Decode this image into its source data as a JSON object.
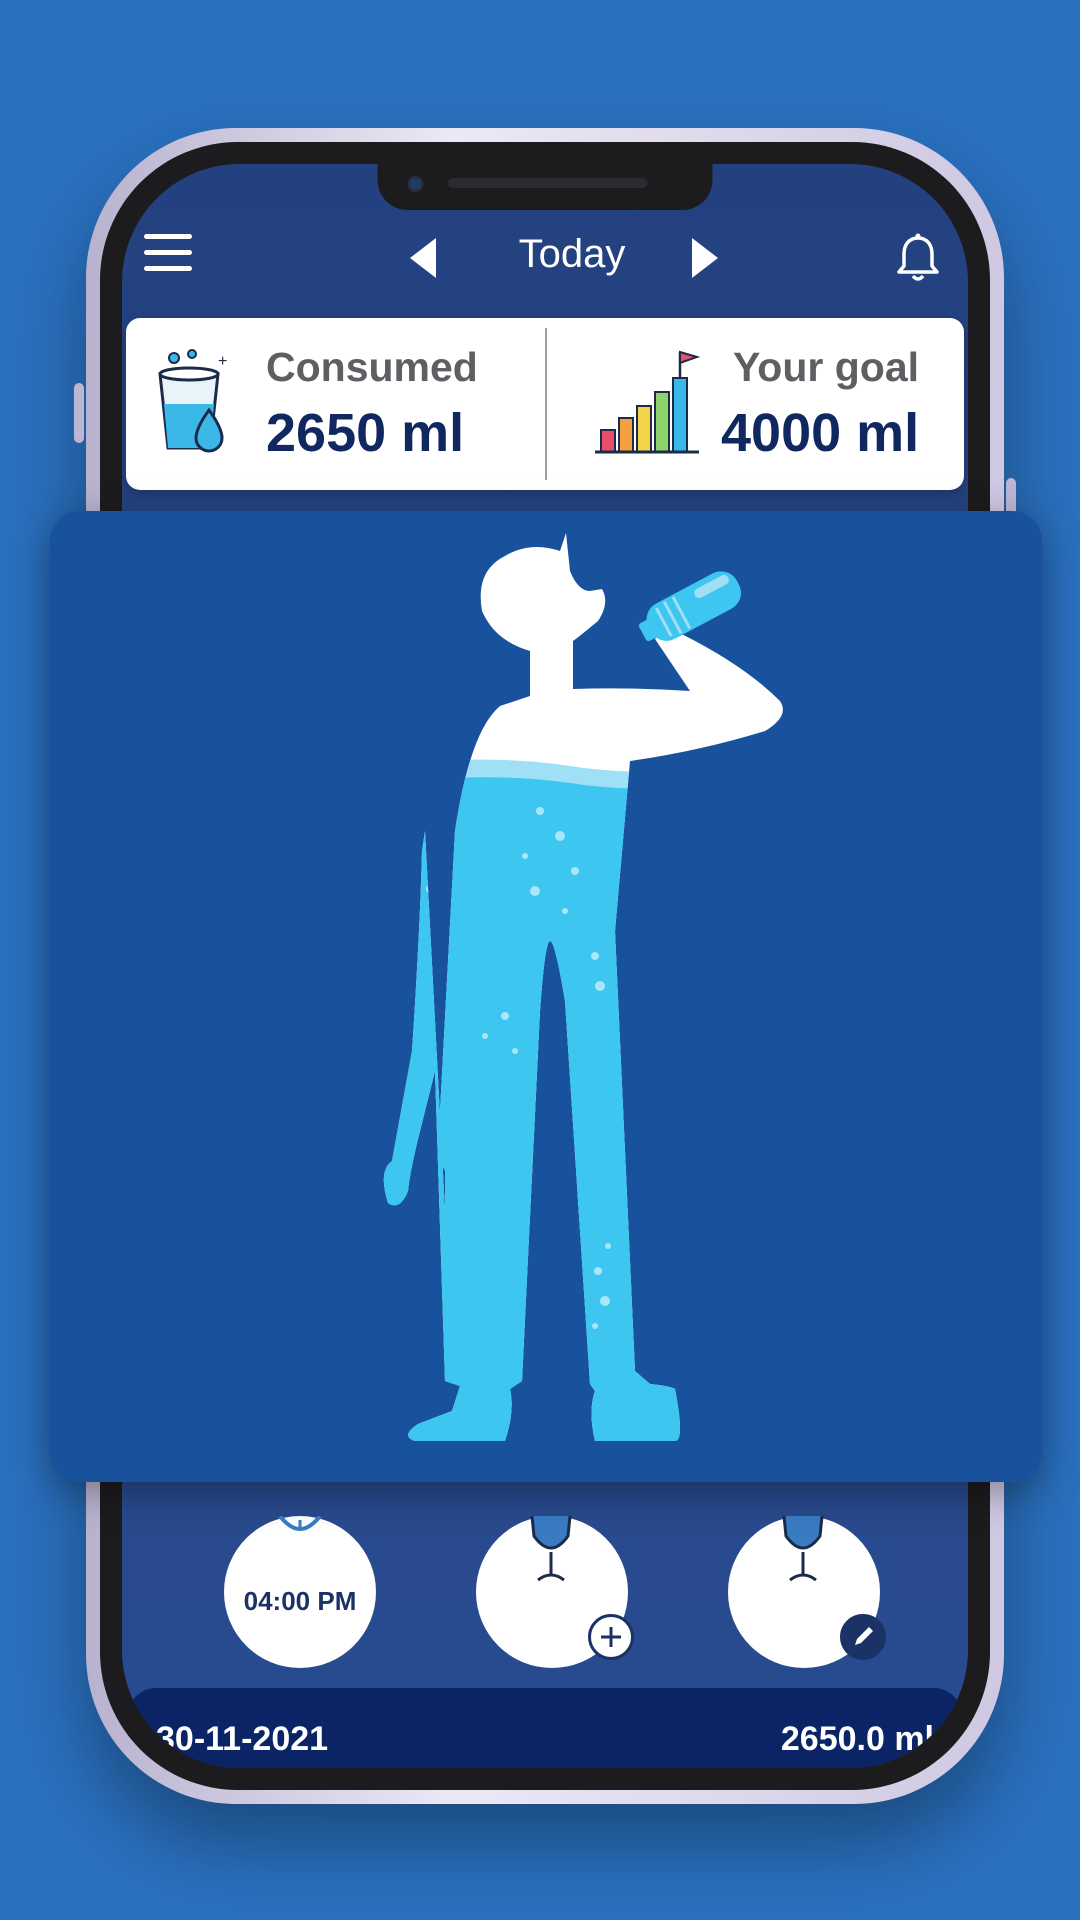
{
  "header": {
    "title": "Today"
  },
  "stats": {
    "consumed_label": "Consumed",
    "consumed_value": "2650 ml",
    "goal_label": "Your goal",
    "goal_value": "4000 ml"
  },
  "actions": {
    "reminder_time": "04:00 PM"
  },
  "footer": {
    "date": "30-11-2021",
    "total": "2650.0 ml"
  },
  "illustration": {
    "subject": "man-drinking-water-icon",
    "fill_level": 0.66
  },
  "colors": {
    "background": "#2a71c0",
    "screen": "#23407f",
    "overlay": "#18529c",
    "water": "#3cc6f0",
    "accent_dark": "#10275f"
  }
}
